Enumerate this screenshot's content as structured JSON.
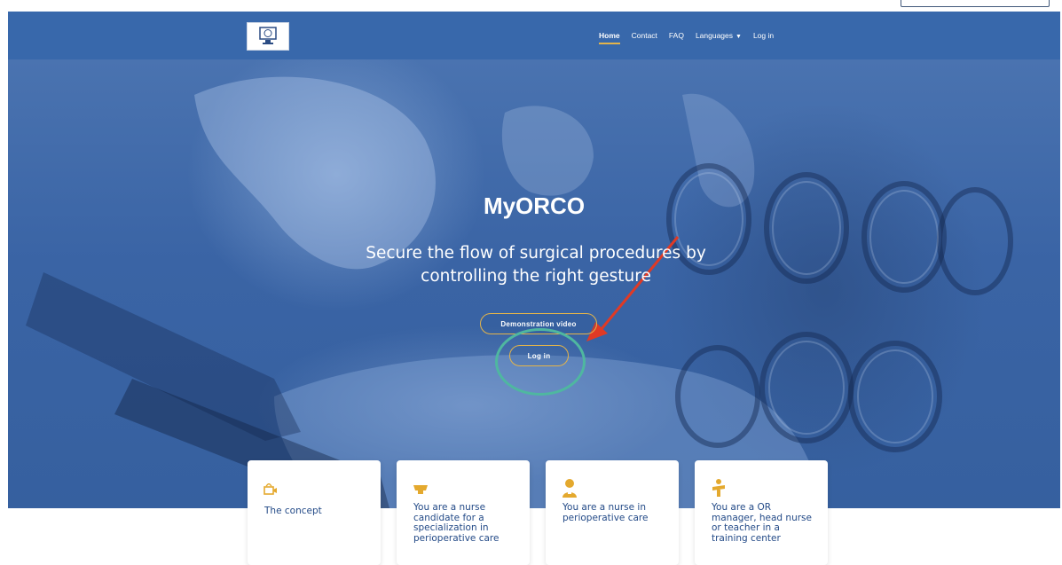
{
  "nav": {
    "items": [
      {
        "label": "Home",
        "active": true
      },
      {
        "label": "Contact"
      },
      {
        "label": "FAQ"
      },
      {
        "label": "Languages",
        "dropdown": true
      },
      {
        "label": "Log in"
      }
    ]
  },
  "hero": {
    "title": "MyORCO",
    "subtitle": "Secure the flow of surgical procedures by controlling the right gesture",
    "demo_button": "Demonstration video",
    "login_button": "Log in"
  },
  "cards": [
    {
      "icon": "video-icon",
      "text": "The concept"
    },
    {
      "icon": "graduation-cap-icon",
      "text": "You are a nurse candidate for a specialization in perioperative care"
    },
    {
      "icon": "nurse-icon",
      "text": "You are a nurse in perioperative care"
    },
    {
      "icon": "manager-icon",
      "text": "You are a OR manager, head nurse or teacher in a training center"
    }
  ],
  "colors": {
    "nav_bg": "#3868ab",
    "accent": "#e4b44a",
    "card_text": "#234a87",
    "annotation_arrow": "#e03a25",
    "annotation_circle": "#4fb7a0"
  }
}
